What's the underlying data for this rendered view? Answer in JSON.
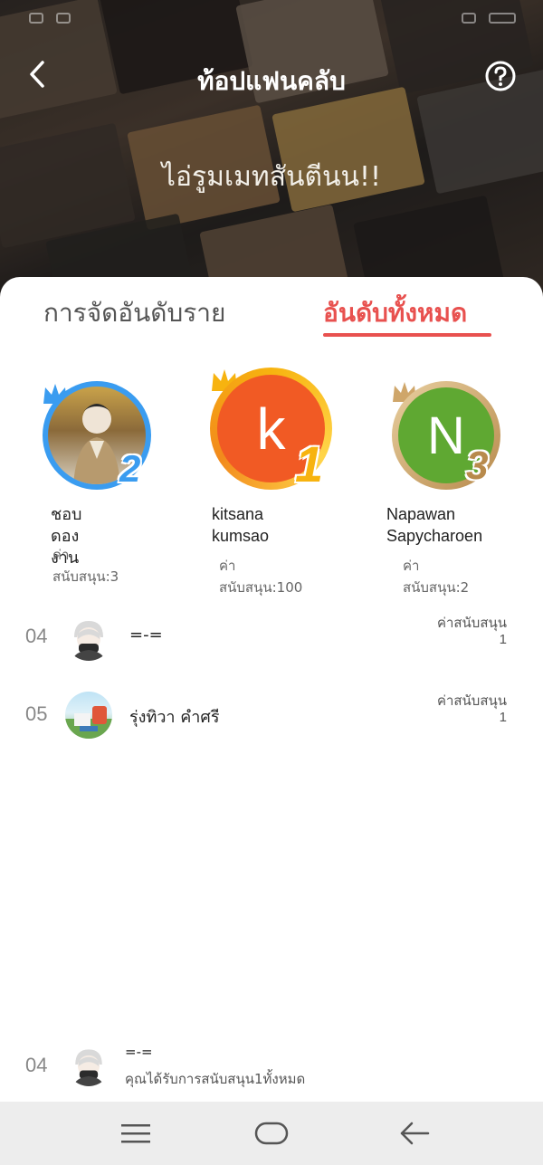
{
  "header": {
    "title": "ท้อปแฟนคลับ",
    "club_name": "ไอ่รูมเมทสันตีนน!!"
  },
  "tabs": [
    {
      "label": "การจัดอันดับราย",
      "active": false
    },
    {
      "label": "อันดับทั้งหมด",
      "active": true
    }
  ],
  "podium": [
    {
      "rank": "2",
      "name": "ชอบดองงาน",
      "score": "ค่าสนับสนุน:3",
      "initial": "",
      "ring_color": "#3a9cf0"
    },
    {
      "rank": "1",
      "name_line1": "kitsana",
      "name_line2": "kumsao",
      "score": "ค่าสนับสนุน:100",
      "initial": "k",
      "ring_color": "#f7b30f"
    },
    {
      "rank": "3",
      "name_line1": "Napawan",
      "name_line2": "Sapycharoen",
      "score": "ค่าสนับสนุน:2",
      "initial": "N",
      "ring_color": "#cfa66a"
    }
  ],
  "list": [
    {
      "rank": "04",
      "name": "=-=",
      "score_label": "ค่าสนับสนุน",
      "score": "1",
      "avatar": "chibi-avatar"
    },
    {
      "rank": "05",
      "name": "รุ่งทิวา คำศรี",
      "score_label": "ค่าสนับสนุน",
      "score": "1",
      "avatar": "landscape-avatar"
    }
  ],
  "me": {
    "rank": "04",
    "name": "=-=",
    "note": "คุณได้รับการสนับสนุน1ทั้งหมด"
  },
  "colors": {
    "accent": "#e8514f",
    "rank1": "#f7b30f",
    "rank2": "#3a9cf0",
    "rank3": "#cfa66a"
  }
}
